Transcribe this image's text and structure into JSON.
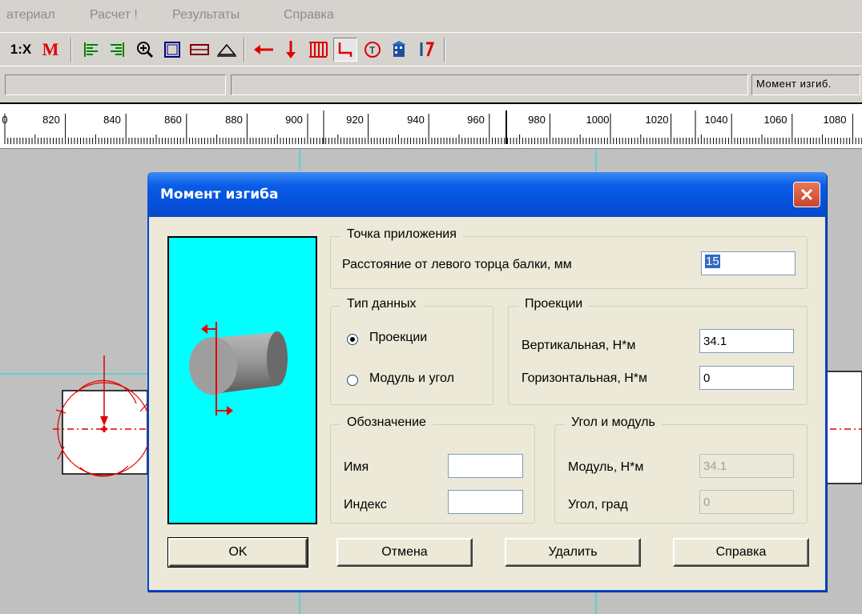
{
  "menu": [
    "атериал",
    "Расчет !",
    "Результаты",
    "Справка"
  ],
  "toolbar": {
    "scale_label": "1:X",
    "moment_label": "M",
    "icons": [
      "scale-icon",
      "moment-icon",
      "align-left-icon",
      "align-right-icon",
      "zoom-in-icon",
      "rectangle-icon",
      "section-icon",
      "support-icon",
      "force-left-icon",
      "force-down-icon",
      "distributed-load-icon",
      "bending-moment-icon",
      "torque-icon",
      "building-icon",
      "rotation-icon"
    ]
  },
  "statusbar": {
    "text": "Момент изгиб."
  },
  "ruler": {
    "ticks": [
      "0",
      "820",
      "840",
      "860",
      "880",
      "900",
      "920",
      "940",
      "960",
      "980",
      "1000",
      "1020",
      "1040",
      "1060",
      "1080"
    ]
  },
  "dialog": {
    "title": "Момент изгиба",
    "application_point": {
      "caption": "Точка приложения",
      "distance_label": "Расстояние от левого торца балки, мм",
      "distance_value": "15"
    },
    "data_type": {
      "caption": "Тип данных",
      "option_projections": "Проекции",
      "option_modulus": "Модуль и угол",
      "selected": "projections"
    },
    "projections": {
      "caption": "Проекции",
      "vertical_label": "Вертикальная, Н*м",
      "vertical_value": "34.1",
      "horizontal_label": "Горизонтальная, Н*м",
      "horizontal_value": "0"
    },
    "designation": {
      "caption": "Обозначение",
      "name_label": "Имя",
      "name_value": "",
      "index_label": "Индекс",
      "index_value": ""
    },
    "angle_modulus": {
      "caption": "Угол и модуль",
      "modulus_label": "Модуль, Н*м",
      "modulus_value": "34.1",
      "angle_label": "Угол, град",
      "angle_value": "0"
    },
    "buttons": {
      "ok": "OK",
      "cancel": "Отмена",
      "delete": "Удалить",
      "help": "Справка"
    }
  }
}
